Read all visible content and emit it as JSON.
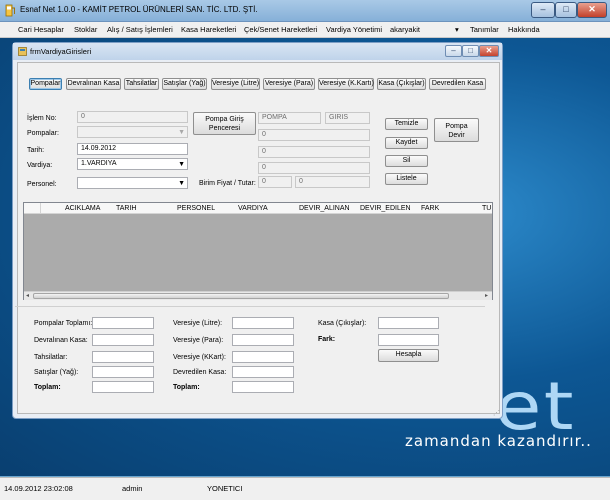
{
  "app": {
    "title": "Esnaf Net 1.0.0 - KAMİT PETROL ÜRÜNLERİ SAN. TİC. LTD. ŞTİ.",
    "controls": {
      "minimize": "–",
      "maximize": "□",
      "close": "✕"
    }
  },
  "menu": {
    "items": [
      "Cari Hesaplar",
      "Stoklar",
      "Alış / Satış İşlemleri",
      "Kasa Hareketleri",
      "Çek/Senet Hareketleri",
      "Vardiya Yönetimi",
      "akaryakit",
      "▾",
      "Tanımlar",
      "Hakkında"
    ]
  },
  "child": {
    "title": "frmVardiyaGirisleri",
    "controls": {
      "minimize": "–",
      "maximize": "□",
      "close": "✕"
    }
  },
  "tabs": [
    "Pompalar",
    "Devralınan Kasa",
    "Tahsilatlar",
    "Satışlar (Yağ)",
    "Veresiye (Litre)",
    "Veresiye (Para)",
    "Veresiye (K.Kartı)",
    "Kasa (Çıkışlar)",
    "Devredilen Kasa"
  ],
  "form": {
    "islem_no_label": "İşlem No:",
    "islem_no_value": "0",
    "pompalar_label": "Pompalar:",
    "pompalar_value": "",
    "tarih_label": "Tarih:",
    "tarih_value": "14.09.2012",
    "vardiya_label": "Vardiya:",
    "vardiya_value": "1.VARDIYA",
    "personel_label": "Personel:",
    "personel_value": "",
    "pompa_giris_button": [
      "Pompa Giriş",
      "Penceresi"
    ],
    "pompa_value": "POMPA",
    "giris_value": "GIRIS",
    "field_a": "0",
    "field_b": "0",
    "field_c": "0",
    "birim_label": "Birim Fiyat / Tutar:",
    "birim_value": "0",
    "tutar_value": "0",
    "temizle": "Temizle",
    "kaydet": "Kaydet",
    "sil": "Sil",
    "listele": "Listele",
    "pompa_devir": [
      "Pompa",
      "Devir"
    ]
  },
  "grid": {
    "columns": [
      "ACIKLAMA",
      "TARIH",
      "PERSONEL",
      "VARDIYA",
      "DEVIR_ALINAN",
      "DEVIR_EDILEN",
      "FARK",
      "TU"
    ],
    "scroll_left": "◂",
    "scroll_right": "▸"
  },
  "summary": {
    "left_labels": [
      "Pompalar Toplamı:",
      "Devralınan Kasa:",
      "Tahsilatlar:",
      "Satışlar (Yağ):",
      "Toplam:"
    ],
    "mid_labels": [
      "Veresiye (Litre):",
      "Veresiye (Para):",
      "Veresiye (KKart):",
      "Devredilen Kasa:",
      "Toplam:"
    ],
    "kasa_label": "Kasa (Çıkışlar):",
    "fark_label": "Fark:",
    "hesapla": "Hesapla"
  },
  "desktop": {
    "brand_text": "et",
    "slogan": "zamandan kazandırır.."
  },
  "status": {
    "datetime": "14.09.2012 23:02:08",
    "user": "admin",
    "role": "YONETICI"
  },
  "colors": {
    "accent": "#3c7fb1",
    "desktop": "#0d5794",
    "close": "#c4432d"
  }
}
